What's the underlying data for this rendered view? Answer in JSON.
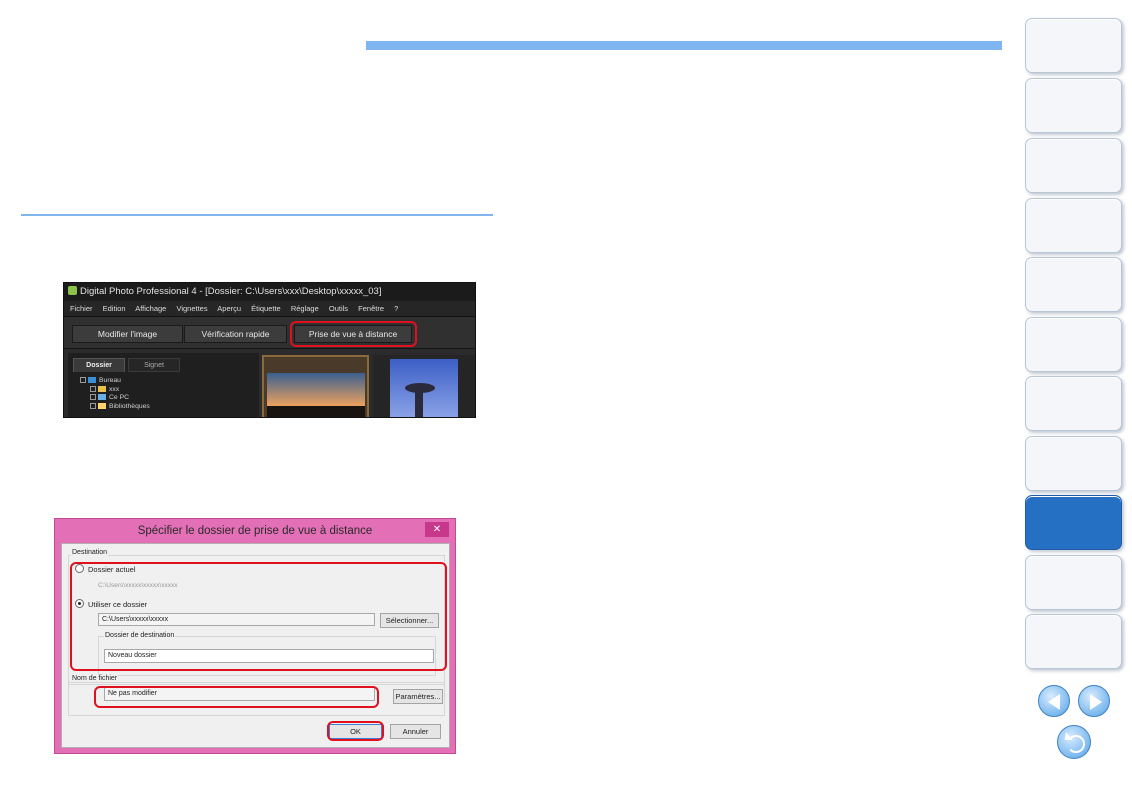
{
  "dpp_window": {
    "title": "Digital Photo Professional 4 - [Dossier: C:\\Users\\xxx\\Desktop\\xxxxx_03]",
    "menu": [
      "Fichier",
      "Edition",
      "Affichage",
      "Vignettes",
      "Aperçu",
      "Étiquette",
      "Réglage",
      "Outils",
      "Fenêtre",
      "?"
    ],
    "toolbar": {
      "edit_image": "Modifier l'image",
      "quick_check": "Vérification rapide",
      "remote_shooting": "Prise de vue à distance"
    },
    "tabs": {
      "folder": "Dossier",
      "bookmark": "Signet"
    },
    "tree": {
      "desktop": "Bureau",
      "folder": "xxx",
      "this_pc": "Ce PC",
      "libraries": "Bibliothèques"
    }
  },
  "dialog": {
    "title": "Spécifier le dossier de prise de vue à distance",
    "close_glyph": "✕",
    "destination_label": "Destination",
    "current_folder_label": "Dossier actuel",
    "current_folder_path": "C:\\Users\\xxxxx\\xxxxx\\xxxxx",
    "use_folder_label": "Utiliser ce dossier",
    "use_folder_path": "C:\\Users\\xxxxx\\xxxxx",
    "select_button": "Sélectionner...",
    "dest_folder_label": "Dossier de destination",
    "dest_folder_value": "Noveau dossier",
    "filename_label": "Nom de fichier",
    "filename_value": "Ne pas modifier",
    "params_button": "Paramètres...",
    "ok_button": "OK",
    "cancel_button": "Annuler",
    "selected_option": "use_folder"
  },
  "navigation": {
    "tab_count": 11,
    "active_tab": 9,
    "icons": [
      "previous-page-icon",
      "next-page-icon",
      "return-icon"
    ]
  }
}
